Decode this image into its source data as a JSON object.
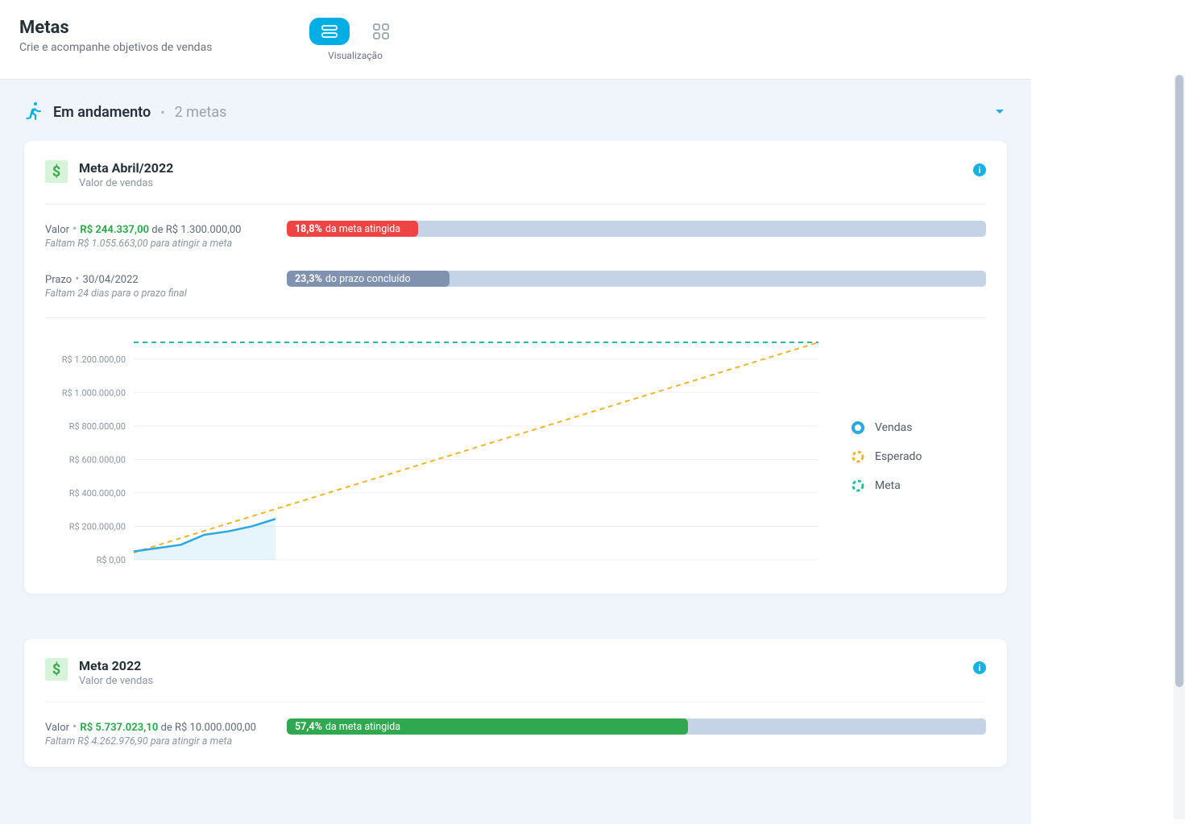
{
  "header": {
    "title": "Metas",
    "subtitle": "Crie e acompanhe objetivos de vendas",
    "view_label": "Visualização"
  },
  "section": {
    "name": "Em andamento",
    "count": "2 metas"
  },
  "cards": [
    {
      "icon": "$",
      "title": "Meta Abril/2022",
      "subtitle": "Valor de vendas",
      "valor": {
        "label": "Valor",
        "current": "R$ 244.337,00",
        "of_word": " de ",
        "target": "R$ 1.300.000,00",
        "remain": "Faltam R$ 1.055.663,00 para atingir a meta",
        "pct": "18,8%",
        "pct_label": " da meta atingida",
        "fill": 18.8,
        "color": "red"
      },
      "prazo": {
        "label": "Prazo",
        "date": "30/04/2022",
        "remain": "Faltam 24 dias para o prazo final",
        "pct": "23,3%",
        "pct_label": " do prazo concluído",
        "fill": 23.3,
        "color": "blue"
      }
    },
    {
      "icon": "$",
      "title": "Meta 2022",
      "subtitle": "Valor de vendas",
      "valor": {
        "label": "Valor",
        "current": "R$ 5.737.023,10",
        "of_word": " de ",
        "target": "R$ 10.000.000,00",
        "remain": "Faltam R$ 4.262.976,90 para atingir a meta",
        "pct": "57,4%",
        "pct_label": " da meta atingida",
        "fill": 57.4,
        "color": "green"
      }
    }
  ],
  "legend": {
    "vendas": "Vendas",
    "esperado": "Esperado",
    "meta": "Meta"
  },
  "chart_data": {
    "type": "line",
    "title": "",
    "xlabel": "",
    "ylabel": "",
    "ylim": [
      0,
      1300000
    ],
    "y_ticks": [
      "R$ 0,00",
      "R$ 200.000,00",
      "R$ 400.000,00",
      "R$ 600.000,00",
      "R$ 800.000,00",
      "R$ 1.000.000,00",
      "R$ 1.200.000,00"
    ],
    "x_days": 30,
    "meta_value": 1300000,
    "series": [
      {
        "name": "Vendas",
        "style": "area-solid",
        "color": "#2aa9e0",
        "values": [
          50000,
          70000,
          90000,
          150000,
          170000,
          200000,
          244337
        ]
      },
      {
        "name": "Esperado",
        "style": "dashed",
        "color": "#f0b429",
        "values_endpoints": {
          "start_day": 1,
          "start_val": 43333,
          "end_day": 30,
          "end_val": 1300000
        }
      },
      {
        "name": "Meta",
        "style": "dashed",
        "color": "#1fbf9c",
        "constant": 1300000
      }
    ]
  }
}
